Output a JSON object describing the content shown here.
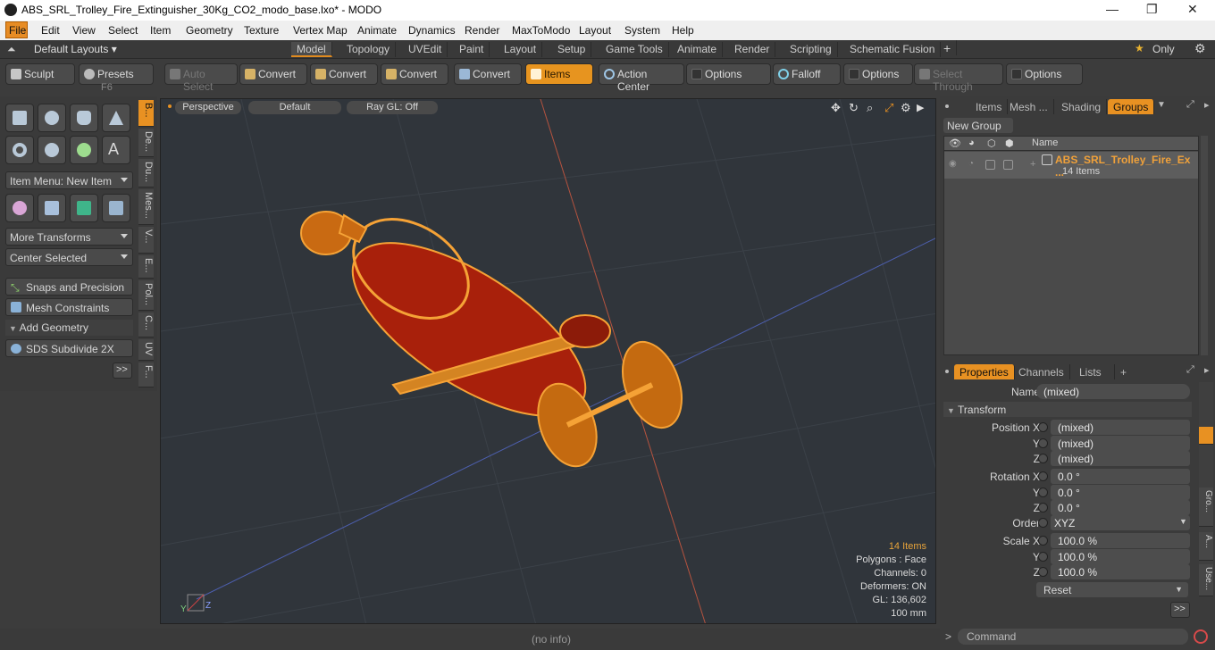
{
  "window": {
    "title": "ABS_SRL_Trolley_Fire_Extinguisher_30Kg_CO2_modo_base.lxo* - MODO",
    "minimize": "—",
    "maximize": "❐",
    "close": "✕"
  },
  "menu": [
    "File",
    "Edit",
    "View",
    "Select",
    "Item",
    "Geometry",
    "Texture",
    "Vertex Map",
    "Animate",
    "Dynamics",
    "Render",
    "MaxToModo",
    "Layout",
    "System",
    "Help"
  ],
  "layouts": {
    "default": "Default Layouts ▾",
    "tabs": [
      "Model",
      "Topology",
      "UVEdit",
      "Paint",
      "Layout",
      "Setup",
      "Game Tools",
      "Animate",
      "Render",
      "Scripting",
      "Schematic Fusion"
    ],
    "add": "+",
    "only": "Only"
  },
  "toolbar": {
    "sculpt": "Sculpt",
    "presets": "Presets",
    "presets_key": "F6",
    "auto_select": "Auto Select",
    "convert1": "Convert",
    "convert2": "Convert",
    "convert3": "Convert",
    "convert4": "Convert",
    "items": "Items",
    "action_center": "Action Center",
    "options1": "Options",
    "falloff": "Falloff",
    "options2": "Options",
    "select_through": "Select Through",
    "options3": "Options"
  },
  "left": {
    "item_menu": "Item Menu: New Item",
    "more_transforms": "More Transforms",
    "center_selected": "Center Selected",
    "snaps": "Snaps and Precision",
    "mesh_constraints": "Mesh Constraints",
    "add_geometry": "Add Geometry",
    "sds": "SDS Subdivide 2X",
    "more": ">>"
  },
  "vtabs": [
    "B...",
    "De...",
    "Du...",
    "Mes...",
    "V...",
    "E...",
    "Pol...",
    "C...",
    "UV",
    "F..."
  ],
  "viewport": {
    "perspective": "Perspective",
    "default": "Default",
    "raygl": "Ray GL: Off",
    "items_count": "14 Items",
    "polygons": "Polygons : Face",
    "channels": "Channels: 0",
    "deformers": "Deformers: ON",
    "gl": "GL: 136,602",
    "scale": "100 mm",
    "axis_y": "Y",
    "axis_z": "Z"
  },
  "groups": {
    "tabs": [
      "Items",
      "Mesh ...",
      "Shading",
      "Groups"
    ],
    "new_group": "New Group",
    "col_name": "Name",
    "group_name": "ABS_SRL_Trolley_Fire_Ex ...",
    "group_count": "14 Items"
  },
  "properties": {
    "tabs": [
      "Properties",
      "Channels",
      "Lists",
      "+"
    ],
    "name_label": "Name",
    "name_value": "(mixed)",
    "transform": "Transform",
    "rows": [
      {
        "label": "Position X",
        "value": "(mixed)"
      },
      {
        "label": "Y",
        "value": "(mixed)"
      },
      {
        "label": "Z",
        "value": "(mixed)"
      },
      {
        "label": "Rotation X",
        "value": "0.0 °"
      },
      {
        "label": "Y",
        "value": "0.0 °"
      },
      {
        "label": "Z",
        "value": "0.0 °"
      },
      {
        "label": "Order",
        "value": "XYZ"
      },
      {
        "label": "Scale X",
        "value": "100.0 %"
      },
      {
        "label": "Y",
        "value": "100.0 %"
      },
      {
        "label": "Z",
        "value": "100.0 %"
      }
    ],
    "reset": "Reset",
    "more": ">>",
    "side_tabs": [
      "Gro...",
      "A...",
      "Use..."
    ]
  },
  "status": {
    "info": "(no info)",
    "command": "Command"
  }
}
